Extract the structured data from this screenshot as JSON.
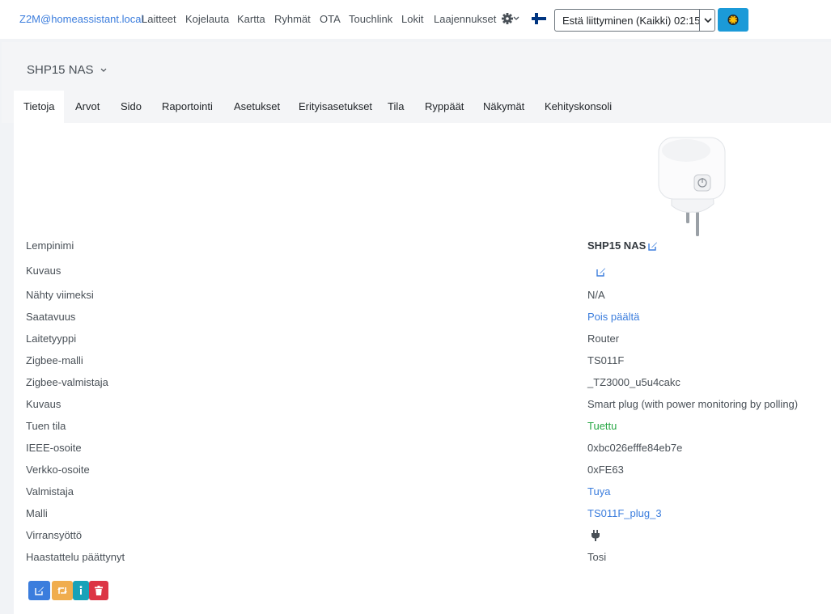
{
  "nav": {
    "brand": "Z2M@homeassistant.local",
    "links": [
      "Laitteet",
      "Kojelauta",
      "Kartta",
      "Ryhmät",
      "OTA",
      "Touchlink",
      "Lokit",
      "Laajennukset"
    ],
    "permit_join": {
      "label": "Estä liittyminen (Kaikki) 02:15"
    }
  },
  "device": {
    "title": "SHP15 NAS",
    "tabs": [
      "Tietoja",
      "Arvot",
      "Sido",
      "Raportointi",
      "Asetukset",
      "Erityisasetukset",
      "Tila",
      "Ryppäät",
      "Näkymät",
      "Kehityskonsoli"
    ],
    "active_tab": "Tietoja"
  },
  "info": {
    "rows": [
      {
        "label": "Lempinimi",
        "value": "SHP15 NAS"
      },
      {
        "label": "Kuvaus",
        "value": ""
      },
      {
        "label": "Nähty viimeksi",
        "value": "N/A"
      },
      {
        "label": "Saatavuus",
        "value": "Pois päältä"
      },
      {
        "label": "Laitetyyppi",
        "value": "Router"
      },
      {
        "label": "Zigbee-malli",
        "value": "TS011F"
      },
      {
        "label": "Zigbee-valmistaja",
        "value": "_TZ3000_u5u4cakc"
      },
      {
        "label": "Kuvaus",
        "value": "Smart plug (with power monitoring by polling)"
      },
      {
        "label": "Tuen tila",
        "value": "Tuettu"
      },
      {
        "label": "IEEE-osoite",
        "value": "0xbc026efffe84eb7e"
      },
      {
        "label": "Verkko-osoite",
        "value": "0xFE63"
      },
      {
        "label": "Valmistaja",
        "value": "Tuya"
      },
      {
        "label": "Malli",
        "value": "TS011F_plug_3"
      },
      {
        "label": "Virransyöttö",
        "value": ""
      },
      {
        "label": "Haastattelu päättynyt",
        "value": "Tosi"
      }
    ]
  },
  "colors": {
    "link": "#3b7ddd",
    "supported": "#28a745",
    "btn_rename": "#3b7ddd",
    "btn_reconfigure": "#f0ad4e",
    "btn_interview": "#17a2b8",
    "btn_remove": "#dc3545"
  }
}
